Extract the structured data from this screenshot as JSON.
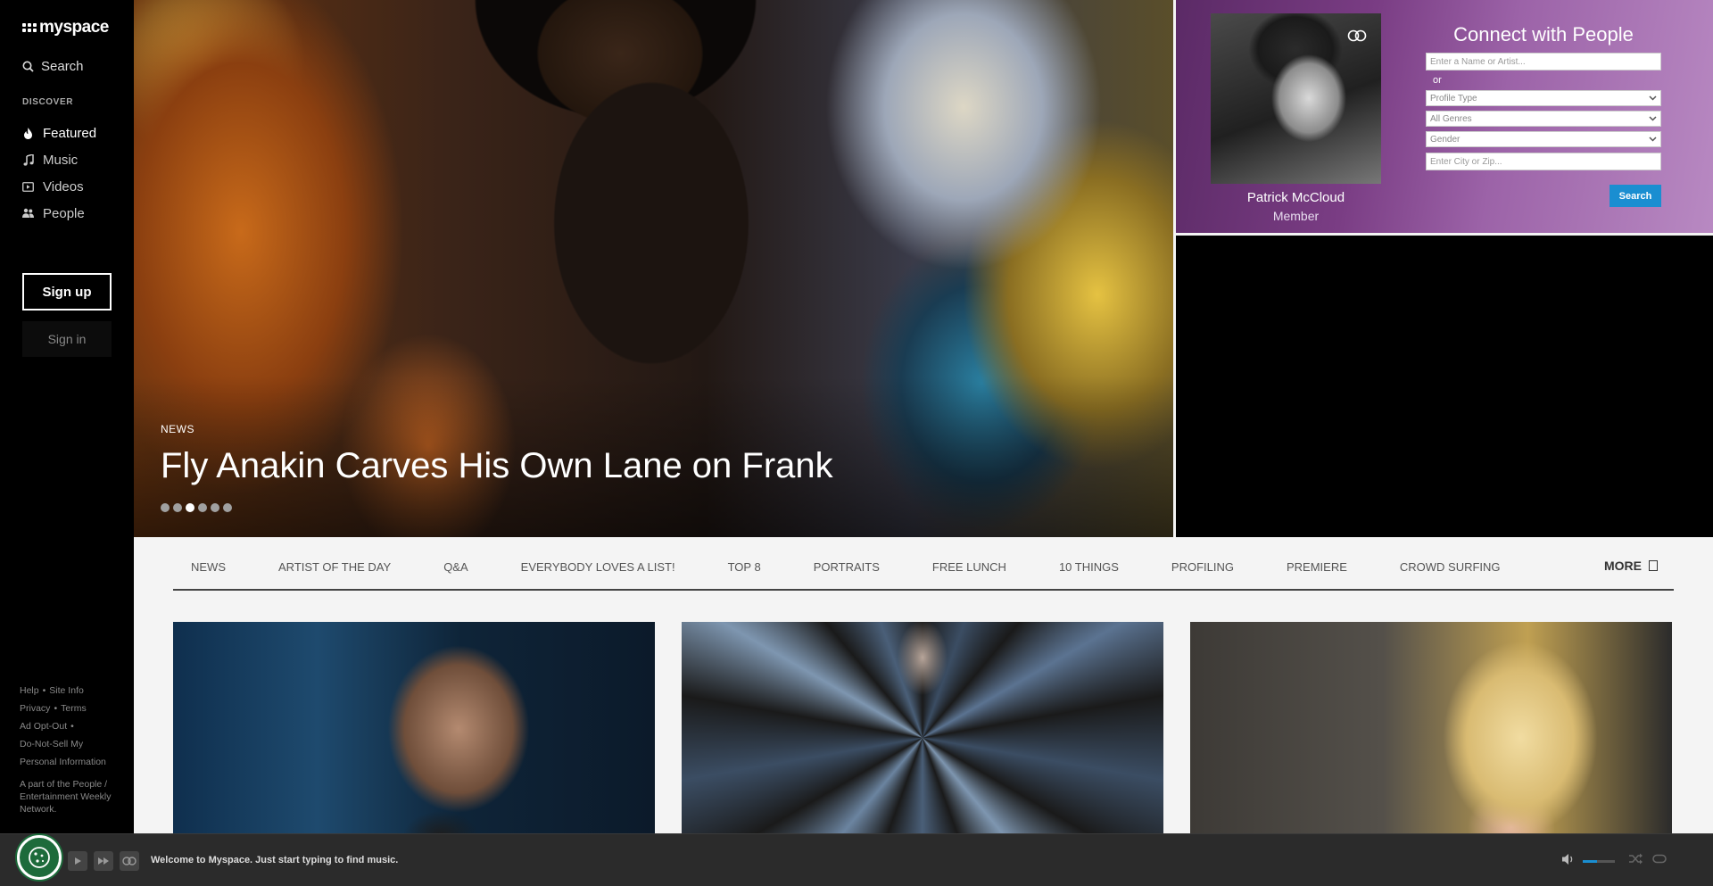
{
  "sidebar": {
    "logo_text": "myspace",
    "search_label": "Search",
    "discover_label": "DISCOVER",
    "nav": [
      {
        "label": "Featured",
        "icon": "flame-icon",
        "active": true
      },
      {
        "label": "Music",
        "icon": "music-note-icon",
        "active": false
      },
      {
        "label": "Videos",
        "icon": "video-icon",
        "active": false
      },
      {
        "label": "People",
        "icon": "people-icon",
        "active": false
      }
    ],
    "signup_label": "Sign up",
    "signin_label": "Sign in",
    "footer": {
      "help": "Help",
      "site_info": "Site Info",
      "privacy": "Privacy",
      "terms": "Terms",
      "ad_opt_out": "Ad Opt-Out",
      "do_not_sell": "Do-Not-Sell My Personal Information",
      "network_note": "A part of the People / Entertainment Weekly Network."
    }
  },
  "hero": {
    "category": "NEWS",
    "title": "Fly Anakin Carves His Own Lane on Frank",
    "slide_count": 6,
    "active_slide": 3
  },
  "connect": {
    "title": "Connect with People",
    "name_placeholder": "Enter a Name or Artist...",
    "or_text": "or",
    "profile_type": "Profile Type",
    "genres": "All Genres",
    "gender": "Gender",
    "city_placeholder": "Enter City or Zip...",
    "search_label": "Search",
    "profile": {
      "name": "Patrick McCloud",
      "role": "Member"
    }
  },
  "tabs": [
    "NEWS",
    "ARTIST OF THE DAY",
    "Q&A",
    "EVERYBODY LOVES A LIST!",
    "TOP 8",
    "PORTRAITS",
    "FREE LUNCH",
    "10 THINGS",
    "PROFILING",
    "PREMIERE",
    "CROWD SURFING"
  ],
  "more_label": "MORE",
  "player": {
    "message": "Welcome to Myspace. Just start typing to find music.",
    "volume": 0.45
  },
  "colors": {
    "accent_blue": "#1a8ed1",
    "sidebar_bg": "#000000",
    "connect_purple": "#7a3d84",
    "cookie_green": "#1d6b3b"
  }
}
